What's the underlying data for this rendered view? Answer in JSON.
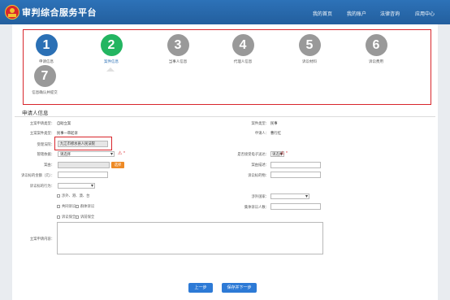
{
  "header": {
    "app_title": "审判综合服务平台",
    "nav": [
      "我的首页",
      "我的账户",
      "法律咨询",
      "应用中心"
    ],
    "colors": {
      "header_bg": "#2d72b8",
      "accent": "#2b70b5"
    }
  },
  "steps": [
    {
      "number": "1",
      "label": "申请信息",
      "color": "#2b70b5"
    },
    {
      "number": "2",
      "label": "案件信息",
      "color": "#23b561"
    },
    {
      "number": "3",
      "label": "当事人信息",
      "color": "#999999"
    },
    {
      "number": "4",
      "label": "代理人信息",
      "color": "#999999"
    },
    {
      "number": "5",
      "label": "诉讼材料",
      "color": "#999999"
    },
    {
      "number": "6",
      "label": "诉讼费用",
      "color": "#999999"
    },
    {
      "number": "7",
      "label": "信息确认并提交",
      "color": "#999999"
    }
  ],
  "form": {
    "section_title": "申请人信息",
    "apply_type": {
      "label": "立案申请类型：",
      "value": "自助立案"
    },
    "case_class": {
      "label": "案件类型：",
      "value": "民事"
    },
    "case_code": {
      "label": "立案案件类型：",
      "value": "民事一审起诉"
    },
    "applicant": {
      "label": "申请人：",
      "value": "曹行红"
    },
    "court": {
      "label": "受理法院：",
      "value": "九江市修水县人民法院"
    },
    "agency": {
      "label": "管辖依据：",
      "value": "请选择"
    },
    "e_delivery": {
      "label": "是否接受电子送达：",
      "value": "请选择"
    },
    "case_cause": {
      "label": "案由：",
      "button": "选择"
    },
    "cause_desc": {
      "label": "案由描述："
    },
    "claim_amount": {
      "label": "诉讼标的金额（元）："
    },
    "claim_object": {
      "label": "诉讼标的物："
    },
    "litigation_act": {
      "label": "诉讼标的行为："
    },
    "foreign_related": {
      "label": "涉外、港、澳、台"
    },
    "foreign_country": {
      "label": "涉外国家："
    },
    "joint_litigation": {
      "label": "共同诉讼"
    },
    "group_litigation": {
      "label": "群体诉讼"
    },
    "litigant_count": {
      "label": "集体诉讼人数："
    },
    "small_claims": {
      "label": "诉讼保全"
    },
    "pre_preservation": {
      "label": "诉前保全"
    },
    "remarks": {
      "label": "立案申请内容："
    }
  },
  "buttons": {
    "prev": "上一步",
    "next": "保存并下一步"
  }
}
